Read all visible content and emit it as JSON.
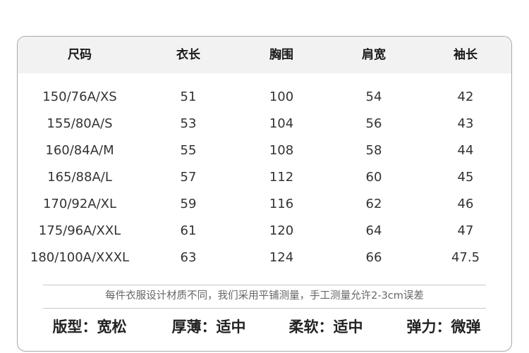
{
  "table": {
    "headers": [
      "尺码",
      "衣长",
      "胸围",
      "肩宽",
      "袖长"
    ],
    "rows": [
      [
        "150/76A/XS",
        "51",
        "100",
        "54",
        "42"
      ],
      [
        "155/80A/S",
        "53",
        "104",
        "56",
        "43"
      ],
      [
        "160/84A/M",
        "55",
        "108",
        "58",
        "44"
      ],
      [
        "165/88A/L",
        "57",
        "112",
        "60",
        "45"
      ],
      [
        "170/92A/XL",
        "59",
        "116",
        "62",
        "46"
      ],
      [
        "175/96A/XXL",
        "61",
        "120",
        "64",
        "47"
      ],
      [
        "180/100A/XXXL",
        "63",
        "124",
        "66",
        "47.5"
      ]
    ]
  },
  "note": "每件衣服设计材质不同，我们采用平铺测量，手工测量允许2-3cm误差",
  "attributes": [
    {
      "label": "版型：",
      "value": "宽松"
    },
    {
      "label": "厚薄：",
      "value": "适中"
    },
    {
      "label": "柔软：",
      "value": "适中"
    },
    {
      "label": "弹力：",
      "value": "微弹"
    }
  ]
}
